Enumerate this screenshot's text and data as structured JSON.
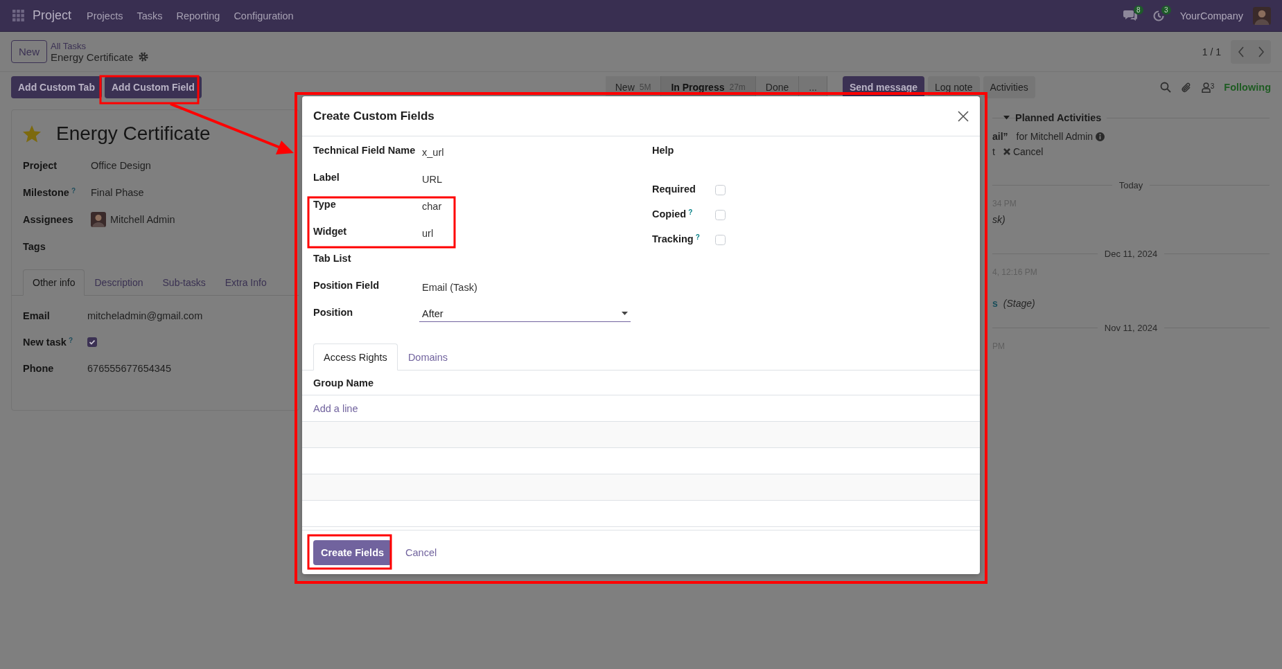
{
  "navbar": {
    "app": "Project",
    "menu": [
      "Projects",
      "Tasks",
      "Reporting",
      "Configuration"
    ],
    "messages_count": "8",
    "activities_count": "3",
    "company": "YourCompany"
  },
  "control_panel": {
    "new_button": "New",
    "breadcrumb": "All Tasks",
    "record": "Energy Certificate",
    "pager": "1 / 1"
  },
  "actions": [
    "Add Custom Tab",
    "Add Custom Field"
  ],
  "stages": [
    {
      "label": "New",
      "duration": "5M",
      "selected": false
    },
    {
      "label": "In Progress",
      "duration": "27m",
      "selected": true
    },
    {
      "label": "Done",
      "selected": false
    },
    {
      "label": "...",
      "selected": false
    }
  ],
  "chatter_buttons": [
    {
      "label": "Send message",
      "primary": true
    },
    {
      "label": "Log note",
      "primary": false
    },
    {
      "label": "Activities",
      "primary": false
    }
  ],
  "followers": {
    "count": "3",
    "label": "Following"
  },
  "task": {
    "starred": true,
    "title": "Energy Certificate",
    "fields": [
      {
        "label": "Project",
        "value": "Office Design",
        "kind": "text"
      },
      {
        "label": "Milestone",
        "help": "?",
        "value": "Final Phase",
        "kind": "text"
      },
      {
        "label": "Assignees",
        "value": "Mitchell Admin",
        "kind": "avatar"
      },
      {
        "label": "Tags",
        "kind": "text"
      }
    ],
    "tabs": [
      {
        "label": "Other info",
        "selected": true
      },
      {
        "label": "Description",
        "selected": false
      },
      {
        "label": "Sub-tasks",
        "selected": false
      },
      {
        "label": "Extra Info",
        "selected": false
      }
    ],
    "info_fields": [
      {
        "label": "Email",
        "value": "mitcheladmin@gmail.com",
        "kind": "text"
      },
      {
        "label": "New task",
        "help": "?",
        "kind": "checkbox",
        "checked": true
      },
      {
        "label": "Phone",
        "value": "676555677654345",
        "kind": "text"
      }
    ]
  },
  "chatter": {
    "section": "Planned Activities",
    "activity": {
      "title_fragment": "ail”",
      "assignee": "for Mitchell Admin",
      "action_fragment": "t",
      "cancel": "Cancel"
    },
    "timeline": [
      {
        "kind": "date",
        "text": "Today"
      },
      {
        "kind": "time",
        "text": "34 PM"
      },
      {
        "kind": "note",
        "text": "sk)"
      },
      {
        "kind": "date",
        "text": "Dec 11, 2024"
      },
      {
        "kind": "time",
        "text": "4, 12:16 PM"
      },
      {
        "kind": "change",
        "link": "s",
        "text": "(Stage)"
      },
      {
        "kind": "date",
        "text": "Nov 11, 2024"
      },
      {
        "kind": "time",
        "text": "PM"
      }
    ]
  },
  "dialog": {
    "title": "Create Custom Fields",
    "left_fields": [
      {
        "label": "Technical Field Name",
        "value": "x_url",
        "kind": "text"
      },
      {
        "label": "Label",
        "value": "URL",
        "kind": "text"
      },
      {
        "label": "Type",
        "value": "char",
        "kind": "text"
      },
      {
        "label": "Widget",
        "value": "url",
        "kind": "text"
      },
      {
        "label": "Tab List",
        "kind": "text"
      },
      {
        "label": "Position Field",
        "value": "Email (Task)",
        "kind": "text"
      },
      {
        "label": "Position",
        "value": "After",
        "kind": "select"
      }
    ],
    "right_fields": [
      {
        "label": "Help",
        "kind": "text"
      },
      {
        "label": "Required",
        "kind": "checkbox",
        "checked": false
      },
      {
        "label": "Copied",
        "help": "?",
        "kind": "checkbox",
        "checked": false
      },
      {
        "label": "Tracking",
        "help": "?",
        "kind": "checkbox",
        "checked": false
      }
    ],
    "tabs": [
      {
        "label": "Access Rights",
        "selected": true
      },
      {
        "label": "Domains",
        "selected": false
      }
    ],
    "table": {
      "columns": [
        "Group Name"
      ],
      "add_line": "Add a line"
    },
    "buttons": [
      {
        "label": "Create Fields",
        "primary": true
      },
      {
        "label": "Cancel",
        "primary": false
      }
    ]
  }
}
